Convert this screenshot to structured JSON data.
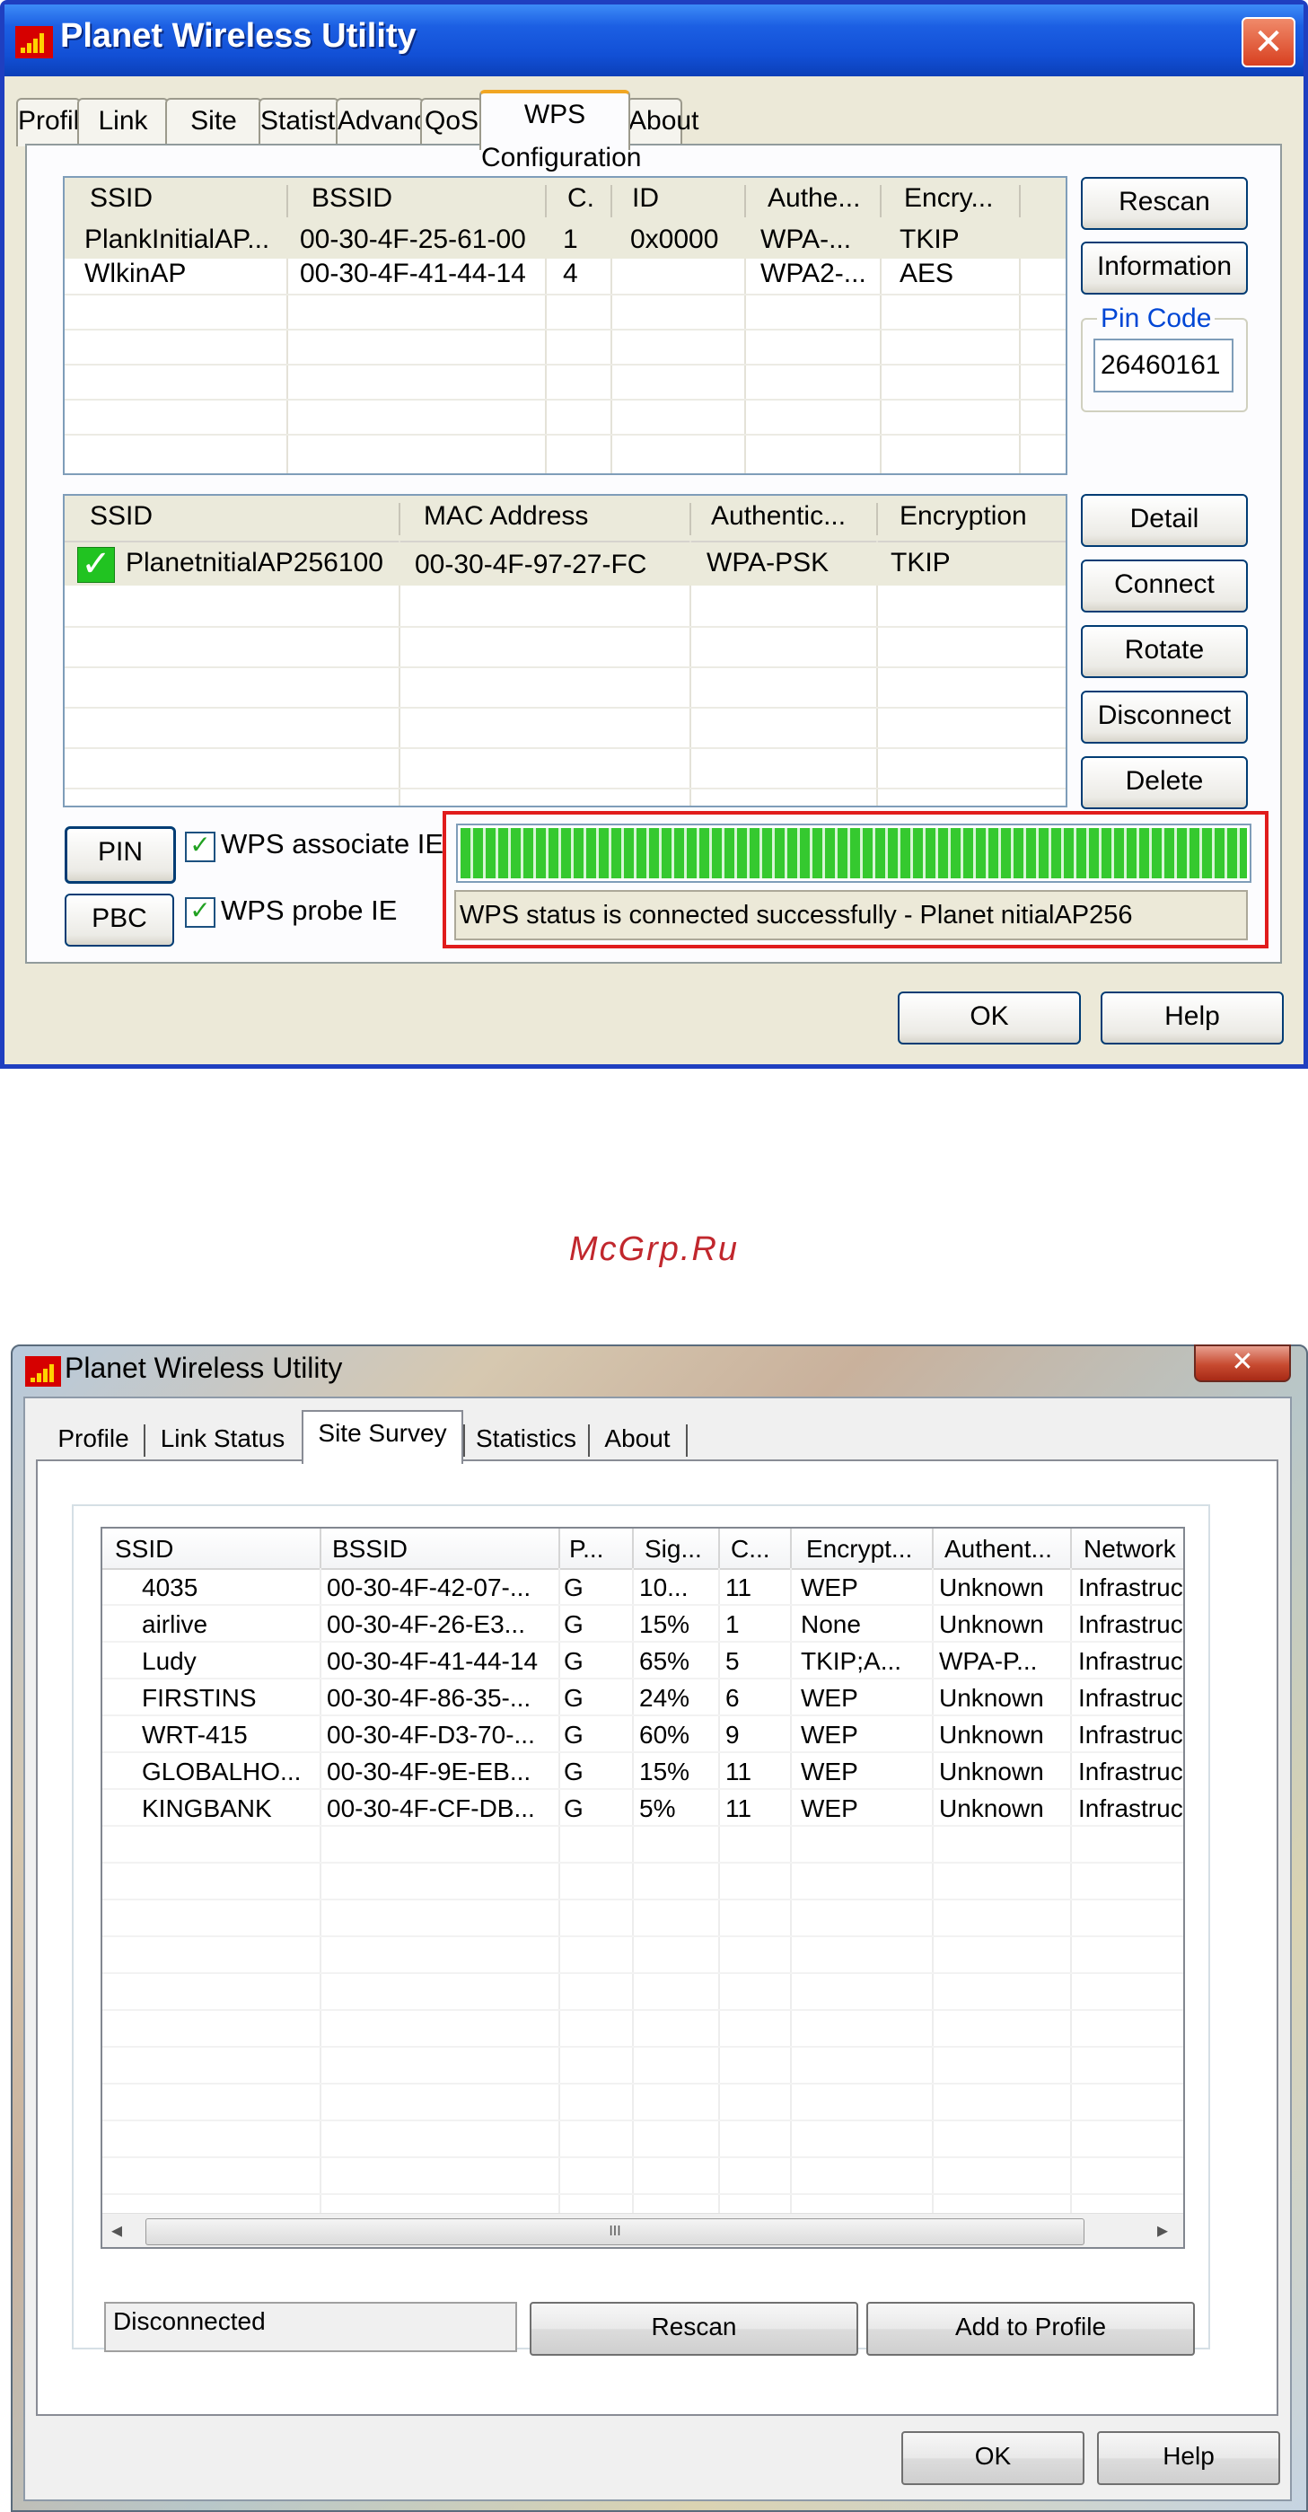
{
  "window1": {
    "title": "Planet Wireless Utility",
    "close_glyph": "✕",
    "tabs": [
      "Profile",
      "Link Status",
      "Site Survey",
      "Statistics",
      "Advanced",
      "QoS",
      "WPS Configuration",
      "About"
    ],
    "ap_list": {
      "columns": [
        "SSID",
        "BSSID",
        "C.",
        "ID",
        "Authe...",
        "Encry..."
      ],
      "rows": [
        [
          "PlankInitialAP...",
          "00-30-4F-25-61-00",
          "1",
          "0x0000",
          "WPA-...",
          "TKIP"
        ],
        [
          "WlkinAP",
          "00-30-4F-41-44-14",
          "4",
          "",
          "WPA2-...",
          "AES"
        ]
      ]
    },
    "buttons_right_top": {
      "rescan": "Rescan",
      "information": "Information"
    },
    "pin_code": {
      "legend": "Pin Code",
      "value": "26460161"
    },
    "profile_list": {
      "columns": [
        "SSID",
        "MAC Address",
        "Authentic...",
        "Encryption"
      ],
      "rows": [
        [
          "PlanetnitialAP256100",
          "00-30-4F-97-27-FC",
          "WPA-PSK",
          "TKIP"
        ]
      ]
    },
    "buttons_right_bottom": {
      "detail": "Detail",
      "connect": "Connect",
      "rotate": "Rotate",
      "disconnect": "Disconnect",
      "delete": "Delete"
    },
    "pin_button": "PIN",
    "pbc_button": "PBC",
    "wps_associate_ie": "WPS associate IE",
    "wps_probe_ie": "WPS probe IE",
    "progress": 1.0,
    "status_text": "WPS status is connected successfully - Planet nitialAP256",
    "ok_button": "OK",
    "help_button": "Help"
  },
  "watermark": "McGrp.Ru",
  "window2": {
    "title": "Planet Wireless Utility",
    "close_glyph": "✕",
    "tabs": [
      "Profile",
      "Link Status",
      "Site Survey",
      "Statistics",
      "About"
    ],
    "columns": [
      "SSID",
      "BSSID",
      "P...",
      "Sig...",
      "C...",
      "Encrypt...",
      "Authent...",
      "Network"
    ],
    "rows": [
      [
        "4035",
        "00-30-4F-42-07-...",
        "G",
        "10...",
        "11",
        "WEP",
        "Unknown",
        "Infrastruc"
      ],
      [
        "airlive",
        "00-30-4F-26-E3...",
        "G",
        "15%",
        "1",
        "None",
        "Unknown",
        "Infrastruc"
      ],
      [
        "Ludy",
        "00-30-4F-41-44-14",
        "G",
        "65%",
        "5",
        "TKIP;A...",
        "WPA-P...",
        "Infrastruc"
      ],
      [
        "FIRSTINS",
        "00-30-4F-86-35-...",
        "G",
        "24%",
        "6",
        "WEP",
        "Unknown",
        "Infrastruc"
      ],
      [
        "WRT-415",
        "00-30-4F-D3-70-...",
        "G",
        "60%",
        "9",
        "WEP",
        "Unknown",
        "Infrastruc"
      ],
      [
        "GLOBALHO...",
        "00-30-4F-9E-EB...",
        "G",
        "15%",
        "11",
        "WEP",
        "Unknown",
        "Infrastruc"
      ],
      [
        "KINGBANK",
        "00-30-4F-CF-DB...",
        "G",
        "5%",
        "11",
        "WEP",
        "Unknown",
        "Infrastruc"
      ]
    ],
    "scroll_thumb_glyph": "III",
    "scroll_left_glyph": "◂",
    "scroll_right_glyph": "▸",
    "status": "Disconnected",
    "rescan_button": "Rescan",
    "add_profile_button": "Add to Profile",
    "ok_button": "OK",
    "help_button": "Help"
  }
}
